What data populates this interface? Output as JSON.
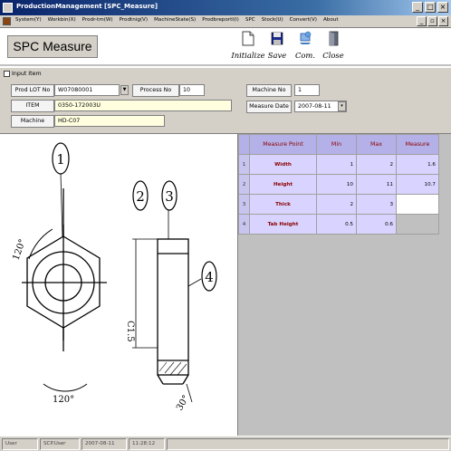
{
  "window": {
    "title": "ProductionManagement [SPC_Measure]",
    "buttons": {
      "minimize": "_",
      "maximize": "□",
      "close": "×"
    }
  },
  "menubar": {
    "items": [
      "System(Y)",
      "Workbin(X)",
      "Prodr-tm(W)",
      "Prodtnig(V)",
      "MachineState(S)",
      "Prodbreportl(I)",
      "SPC",
      "Stock(U)",
      "Convert(V)",
      "About"
    ],
    "mdi_buttons": {
      "minimize": "_",
      "restore": "▫",
      "close": "×"
    }
  },
  "header": {
    "screen_title": "SPC Measure",
    "toolbar": [
      {
        "label": "Initialize",
        "icon": "document-icon"
      },
      {
        "label": "Save",
        "icon": "floppy-disk-icon"
      },
      {
        "label": "Com.",
        "icon": "communication-icon"
      },
      {
        "label": "Close",
        "icon": "exit-door-icon"
      }
    ]
  },
  "input_item": {
    "group_label": "Input Item",
    "prod_lot_label": "Prod LOT No",
    "prod_lot_value": "W07080001",
    "process_label": "Process No",
    "process_value": "10",
    "item_label": "ITEM",
    "item_value": "0350-172003U",
    "machine_label": "Machine",
    "machine_value": "HD-C07",
    "machine_no_label": "Machine No",
    "machine_no_value": "1",
    "measure_date_label": "Measure Date",
    "measure_date_value": "2007-08-11"
  },
  "drawing": {
    "callouts": [
      "1",
      "2",
      "3",
      "4"
    ],
    "dimensions": {
      "angle_top": "120°",
      "angle_bottom": "120°",
      "chamfer": "C1.5",
      "angle_right": "30°"
    }
  },
  "measure_grid": {
    "headers": [
      "Measure Point",
      "Min",
      "Max",
      "Measure"
    ],
    "rows": [
      {
        "row_num": "1",
        "point": "Width",
        "min": "1",
        "max": "2",
        "measure": "1.6"
      },
      {
        "row_num": "2",
        "point": "Height",
        "min": "10",
        "max": "11",
        "measure": "10.7"
      },
      {
        "row_num": "3",
        "point": "Thick",
        "min": "2",
        "max": "3",
        "measure": ""
      },
      {
        "row_num": "4",
        "point": "Tab Height",
        "min": "0.5",
        "max": "0.6",
        "measure": ""
      }
    ]
  },
  "statusbar": {
    "cells": [
      "User",
      "SCP.User",
      "2007-08-11",
      "11:28:12"
    ]
  },
  "colors": {
    "titlebar": "#0a246a",
    "grid_header": "#b4b0e8",
    "grid_cell": "#d8d4ff",
    "grid_text": "#8b0000",
    "field_yellow": "#ffffe0"
  }
}
